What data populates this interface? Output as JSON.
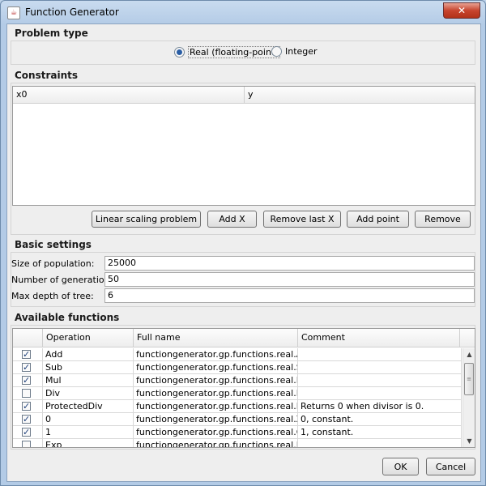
{
  "window": {
    "title": "Function Generator",
    "close_label": "✕"
  },
  "problem_type": {
    "title": "Problem type",
    "options": [
      {
        "label": "Real (floating-point)",
        "checked": true
      },
      {
        "label": "Integer",
        "checked": false
      }
    ]
  },
  "constraints": {
    "title": "Constraints",
    "columns": [
      "x0",
      "y"
    ],
    "buttons": [
      "Linear scaling problem",
      "Add X",
      "Remove last X",
      "Add point",
      "Remove"
    ]
  },
  "basic_settings": {
    "title": "Basic settings",
    "fields": [
      {
        "label": "Size of population:",
        "value": "25000"
      },
      {
        "label": "Number of generations:",
        "value": "50"
      },
      {
        "label": "Max depth of tree:",
        "value": "6"
      }
    ]
  },
  "available_functions": {
    "title": "Available functions",
    "columns": [
      "",
      "Operation",
      "Full name",
      "Comment"
    ],
    "rows": [
      {
        "checked": true,
        "operation": "Add",
        "full_name": "functiongenerator.gp.functions.real.Add",
        "comment": ""
      },
      {
        "checked": true,
        "operation": "Sub",
        "full_name": "functiongenerator.gp.functions.real.Sub",
        "comment": ""
      },
      {
        "checked": true,
        "operation": "Mul",
        "full_name": "functiongenerator.gp.functions.real.Mul",
        "comment": ""
      },
      {
        "checked": false,
        "operation": "Div",
        "full_name": "functiongenerator.gp.functions.real.Div",
        "comment": ""
      },
      {
        "checked": true,
        "operation": "ProtectedDiv",
        "full_name": "functiongenerator.gp.functions.real.Pr...",
        "comment": "Returns 0 when divisor is 0."
      },
      {
        "checked": true,
        "operation": "0",
        "full_name": "functiongenerator.gp.functions.real.Zero",
        "comment": "0, constant."
      },
      {
        "checked": true,
        "operation": "1",
        "full_name": "functiongenerator.gp.functions.real.One",
        "comment": "1, constant."
      },
      {
        "checked": false,
        "operation": "Exp",
        "full_name": "functiongenerator.gp.functions.real.Exp",
        "comment": ""
      }
    ]
  },
  "footer": {
    "ok_label": "OK",
    "cancel_label": "Cancel"
  }
}
